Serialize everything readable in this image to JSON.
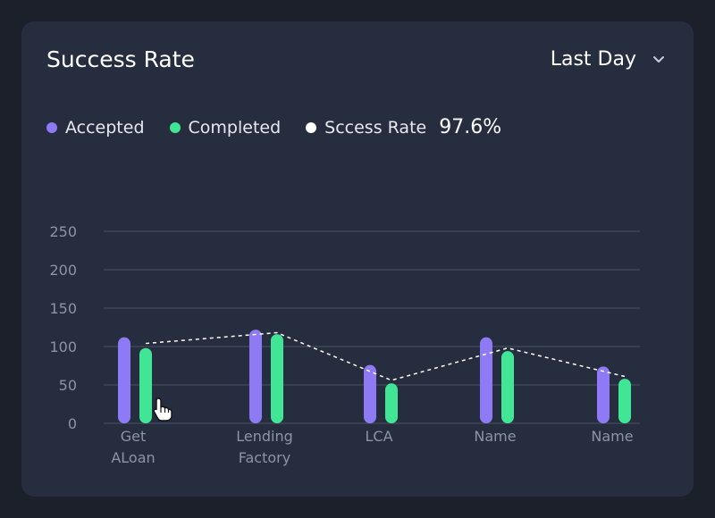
{
  "header": {
    "title": "Success Rate",
    "period_label": "Last Day"
  },
  "legend": {
    "accepted_label": "Accepted",
    "completed_label": "Completed",
    "rate_label": "Sccess Rate",
    "rate_value": "97.6%"
  },
  "colors": {
    "accepted": "#8f7af5",
    "completed": "#41e596",
    "rate": "#ffffff",
    "grid": "#4b5366"
  },
  "chart_data": {
    "type": "bar",
    "categories": [
      [
        "Get",
        "ALoan"
      ],
      [
        "Lending",
        "Factory"
      ],
      [
        "LCA"
      ],
      [
        "Name"
      ],
      [
        "Name"
      ]
    ],
    "series": [
      {
        "name": "Accepted",
        "values": [
          112,
          122,
          76,
          112,
          74
        ]
      },
      {
        "name": "Completed",
        "values": [
          98,
          116,
          52,
          94,
          58
        ]
      }
    ],
    "rate_line": [
      104,
      118,
      56,
      98,
      61
    ],
    "yticks": [
      0,
      50,
      100,
      150,
      200,
      250
    ],
    "ylim": [
      0,
      250
    ],
    "grid": true,
    "legend_position": "top-left"
  }
}
